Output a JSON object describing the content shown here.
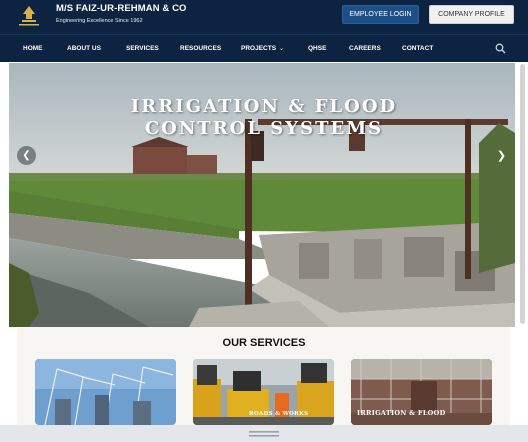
{
  "brand": {
    "title": "M/S FAIZ-UR-REHMAN & CO",
    "tagline": "Engineering Excellence Since 1962",
    "logo_icon": "company-logo-icon"
  },
  "header_buttons": {
    "employee_login": "EMPLOYEE LOGIN",
    "company_profile": "COMPANY PROFILE"
  },
  "nav": {
    "items": [
      {
        "label": "HOME"
      },
      {
        "label": "ABOUT US"
      },
      {
        "label": "SERVICES"
      },
      {
        "label": "RESOURCES"
      },
      {
        "label": "PROJECTS",
        "has_dropdown": true
      },
      {
        "label": "QHSE"
      },
      {
        "label": "CAREERS"
      },
      {
        "label": "CONTACT"
      }
    ],
    "search_icon": "search-icon"
  },
  "hero": {
    "title_line1": "IRRIGATION & FLOOD",
    "title_line2": "CONTROL SYSTEMS",
    "prev_icon": "chevron-left-icon",
    "next_icon": "chevron-right-icon"
  },
  "services": {
    "heading": "OUR SERVICES",
    "cards": [
      {
        "caption": ""
      },
      {
        "caption": "ROADS & WORKS"
      },
      {
        "caption": "IRRIGATION & FLOOD"
      }
    ]
  },
  "colors": {
    "header_bg": "#0c2341",
    "accent_button": "#1e4f86"
  }
}
